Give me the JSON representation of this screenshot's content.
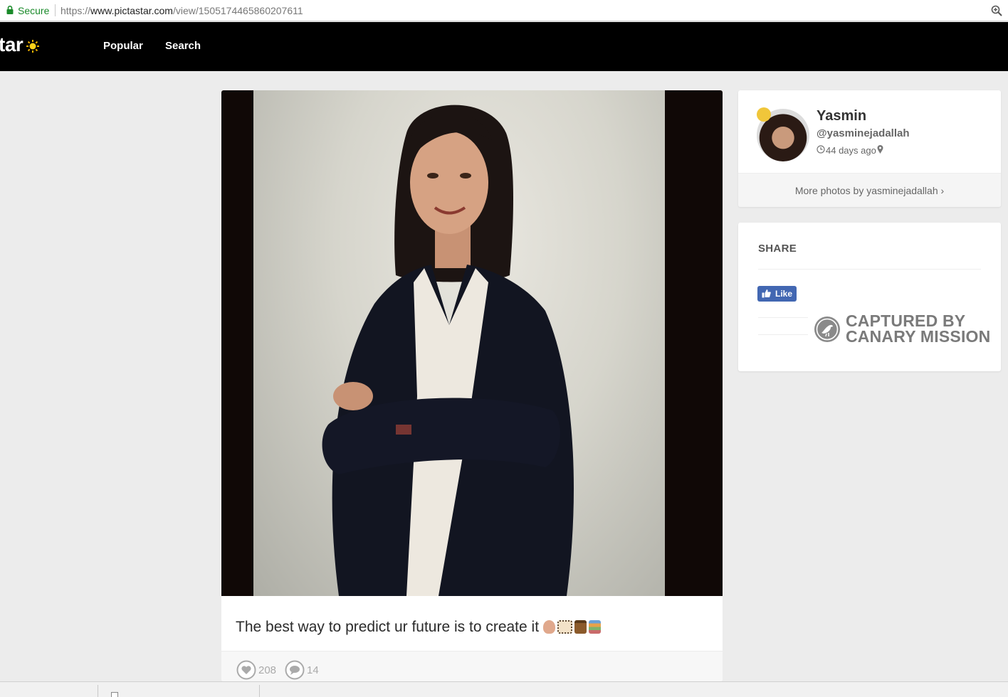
{
  "browser": {
    "secure_label": "Secure",
    "url_scheme": "https://",
    "url_host": "www.pictastar.com",
    "url_path": "/view/1505174465860207611"
  },
  "site": {
    "logo_text": "tar",
    "nav": [
      {
        "label": "Popular"
      },
      {
        "label": "Search"
      }
    ]
  },
  "post": {
    "caption": "The best way to predict ur future is to create it",
    "likes": "208",
    "comments": "14"
  },
  "profile": {
    "name": "Yasmin",
    "handle": "@yasminejadallah",
    "time_ago": "44 days ago",
    "more_link": "More photos by yasminejadallah ›"
  },
  "share": {
    "title": "SHARE",
    "fb_like_label": "Like"
  },
  "watermark": {
    "line1": "CAPTURED BY",
    "line2": "CANARY MISSION"
  },
  "colors": {
    "header_bg": "#000000",
    "page_bg": "#ececec",
    "secure_green": "#1a8a2a",
    "fb_blue": "#4267b2",
    "watermark_gray": "#7a7a7a"
  },
  "icons": [
    "lock-icon",
    "zoom-icon",
    "sun-icon",
    "heart-icon",
    "comment-icon",
    "clock-icon",
    "location-pin-icon",
    "thumbs-up-icon",
    "canary-bird-icon"
  ]
}
